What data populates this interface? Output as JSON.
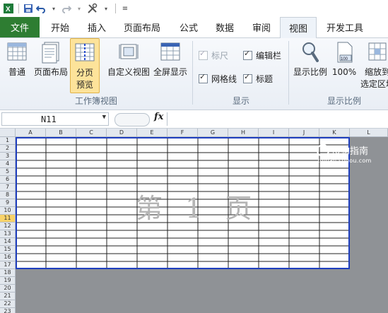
{
  "qat": {
    "icons": [
      "excel-logo-icon",
      "save-icon",
      "undo-icon",
      "redo-icon",
      "tools-icon",
      "customize-qat-icon"
    ]
  },
  "tabs": [
    "文件",
    "开始",
    "插入",
    "页面布局",
    "公式",
    "数据",
    "审阅",
    "视图",
    "开发工具"
  ],
  "active_tab": "视图",
  "ribbon": {
    "workbook_views": {
      "label": "工作簿视图",
      "normal": "普通",
      "page_layout": "页面布局",
      "page_break_1": "分页",
      "page_break_2": "预览",
      "custom_views": "自定义视图",
      "full_screen": "全屏显示"
    },
    "show": {
      "label": "显示",
      "ruler": "标尺",
      "formula_bar": "编辑栏",
      "gridlines": "网格线",
      "headings": "标题"
    },
    "zoom": {
      "label": "显示比例",
      "zoom": "显示比例",
      "hundred": "100%",
      "zoom_sel_1": "缩放到",
      "zoom_sel_2": "选定区域"
    }
  },
  "formula_bar": {
    "name_box": "N11",
    "fx": "fx",
    "value": ""
  },
  "sheet": {
    "columns": [
      "A",
      "B",
      "C",
      "D",
      "E",
      "F",
      "G",
      "H",
      "I",
      "J",
      "K",
      "L"
    ],
    "rows": [
      "1",
      "2",
      "3",
      "4",
      "5",
      "6",
      "7",
      "8",
      "9",
      "10",
      "11",
      "12",
      "13",
      "14",
      "15",
      "16",
      "17",
      "18",
      "19",
      "20",
      "21",
      "22",
      "23"
    ],
    "active_row": "11",
    "page_watermark": "第 1 页"
  },
  "brand": {
    "name": "搜狗指南",
    "url": "zhinan.sogou.com"
  },
  "colors": {
    "file_tab": "#2e7d32",
    "page_border": "#1f3fbf",
    "outside_page": "#8f9296",
    "selected_button": "#fde39a"
  }
}
